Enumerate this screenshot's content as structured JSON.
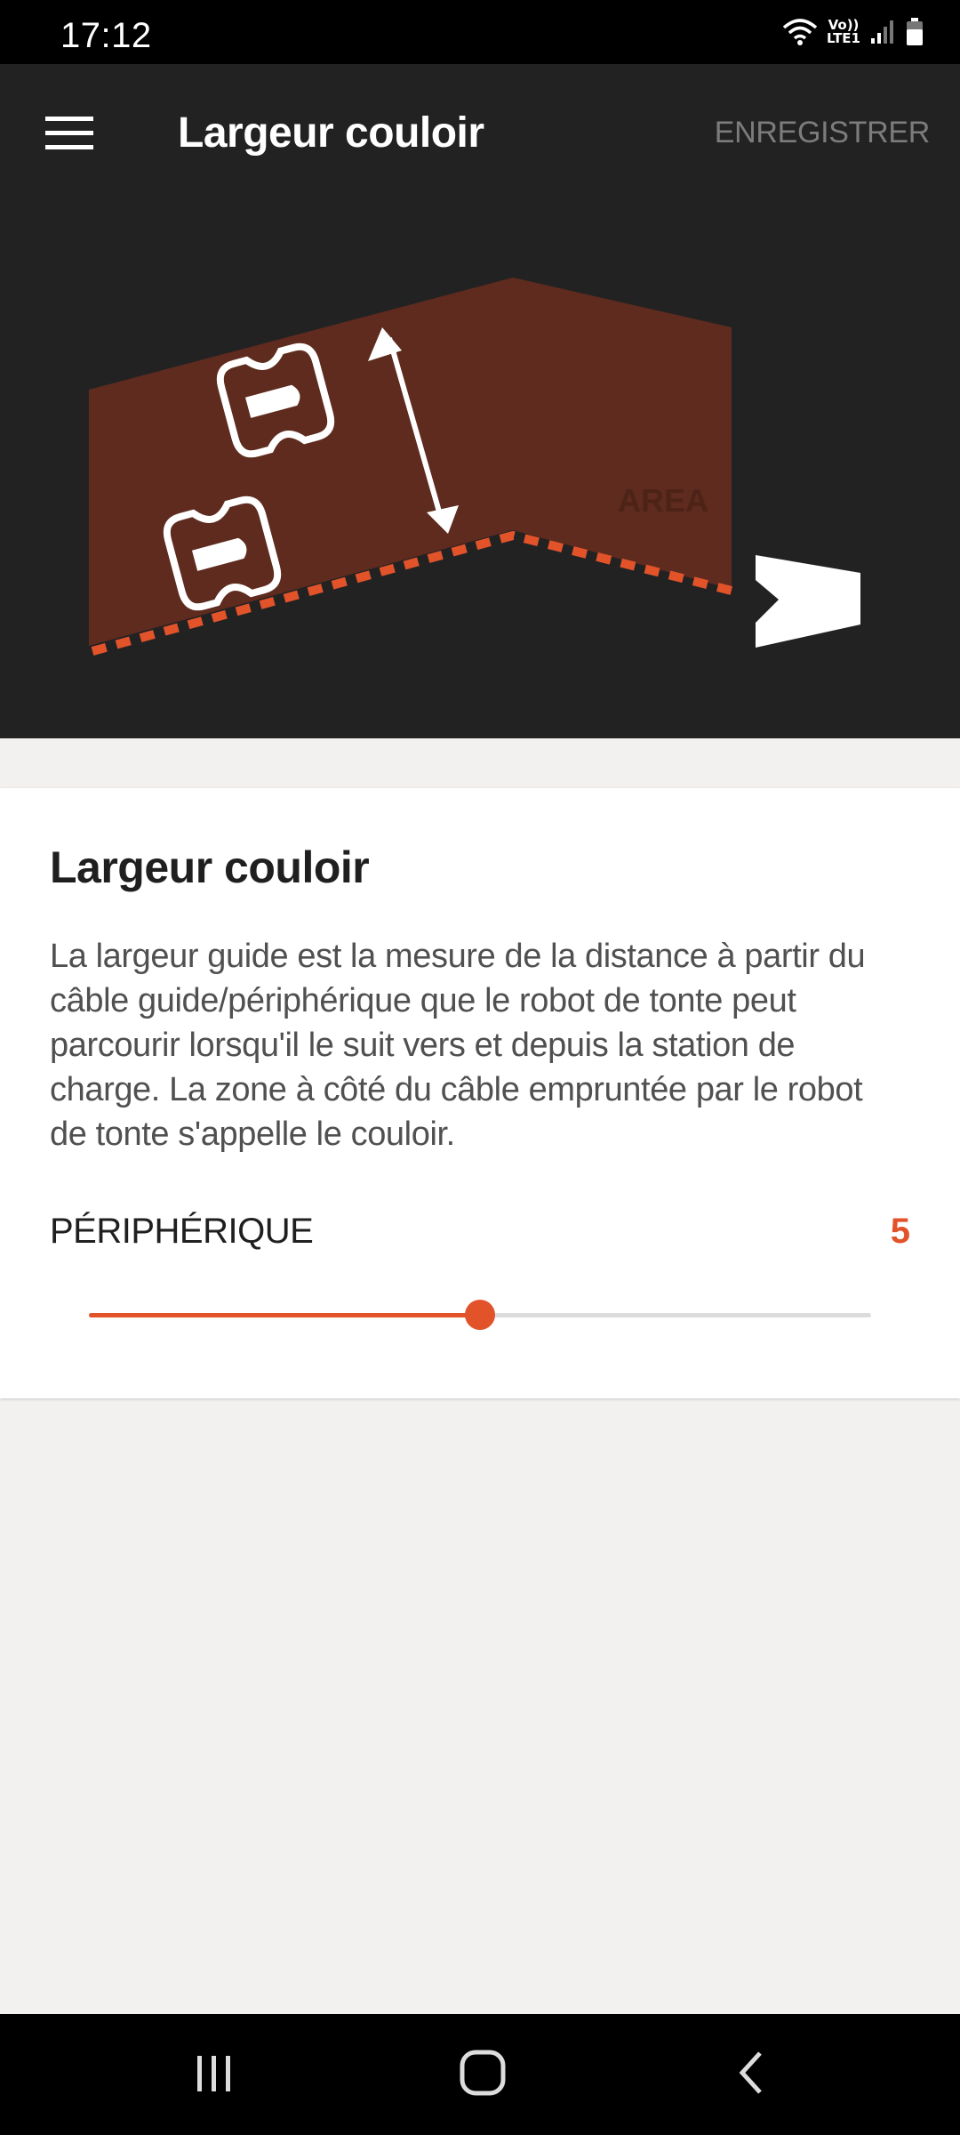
{
  "status_bar": {
    "time": "17:12",
    "network_label_top": "Vo))",
    "network_label_bottom": "LTE1",
    "icons": [
      "wifi-icon",
      "lte-icon",
      "signal-icon",
      "battery-icon"
    ]
  },
  "app_bar": {
    "menu_icon": "hamburger-menu-icon",
    "title": "Largeur couloir",
    "save_label": "ENREGISTRER"
  },
  "illustration": {
    "description_icons": [
      "robot-mower-icon",
      "double-arrow-icon",
      "charging-station-icon"
    ],
    "colors": {
      "background": "#222223",
      "corridor": "#5e2b1e",
      "wire": "#e2532a",
      "icon": "#ffffff"
    }
  },
  "card": {
    "title": "Largeur couloir",
    "description": "La largeur guide est la mesure de la distance à partir du câble guide/périphérique que le robot de tonte peut parcourir lorsqu'il le suit vers et depuis la station de charge. La zone à côté du câble empruntée par le robot de tonte s'appelle le couloir.",
    "setting": {
      "label": "PÉRIPHÉRIQUE",
      "value": "5",
      "slider_fraction": 0.5
    }
  },
  "colors": {
    "accent": "#e2532a",
    "app_bar": "#222223",
    "page_background": "#f2f1f0"
  },
  "nav_bar": {
    "icons": [
      "recent-apps-icon",
      "home-icon",
      "back-icon"
    ]
  }
}
